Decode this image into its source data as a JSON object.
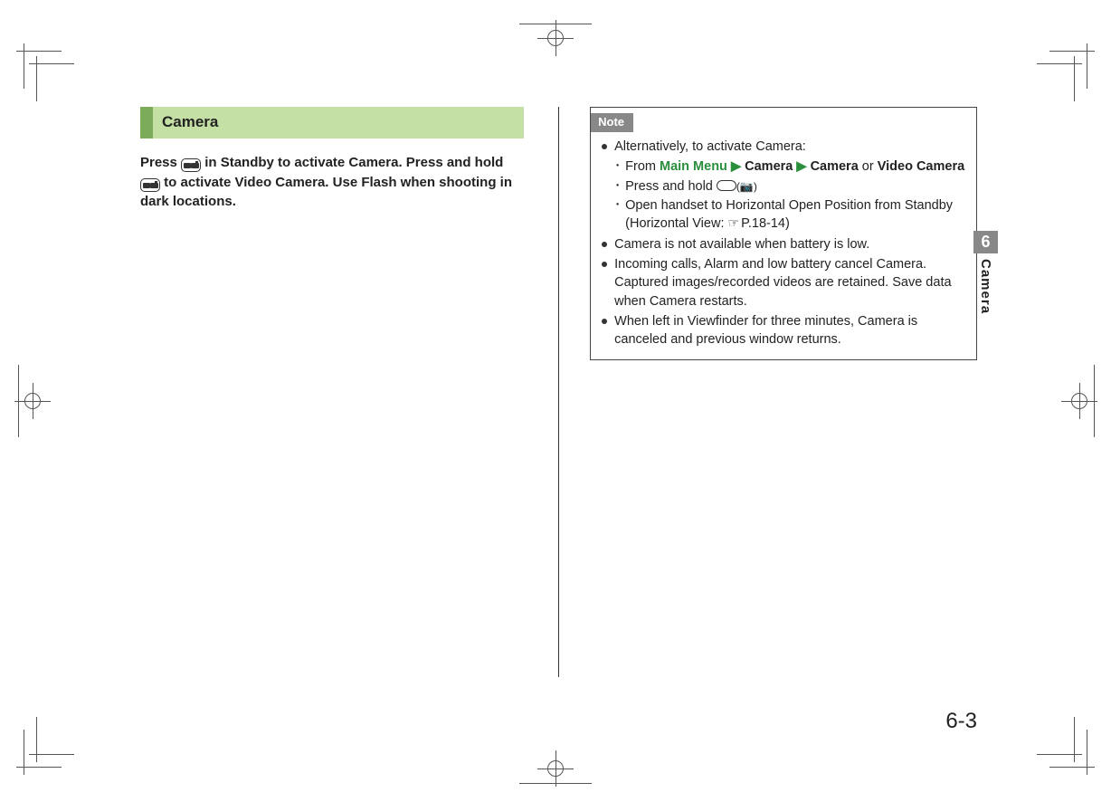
{
  "section": {
    "title": "Camera"
  },
  "intro": {
    "p1a": "Press ",
    "p1b": " in Standby to activate Camera. Press and hold ",
    "p1c": " to activate Video Camera. Use Flash when shooting in dark locations."
  },
  "note": {
    "label": "Note",
    "items": [
      {
        "text": "Alternatively, to activate Camera:",
        "sub": [
          {
            "pre": "From ",
            "link": "Main Menu",
            "tri1": " ▶ ",
            "b1": "Camera",
            "tri2": " ▶ ",
            "b2": "Camera",
            "mid": " or ",
            "b3": "Video Camera"
          },
          {
            "pre": "Press and hold ",
            "key": true,
            "post_paren": "(📷)"
          },
          {
            "pre": "Open handset to Horizontal Open Position from Standby (Horizontal View: ",
            "ref_icon": "☞",
            "ref": "P.18-14)",
            "post": ""
          }
        ]
      },
      {
        "text": "Camera is not available when battery is low."
      },
      {
        "text": "Incoming calls, Alarm and low battery cancel Camera. Captured images/recorded videos are retained. Save data when Camera restarts."
      },
      {
        "text": "When left in Viewfinder for three minutes, Camera is canceled and previous window returns."
      }
    ]
  },
  "sidetab": {
    "num": "6",
    "text": "Camera"
  },
  "page_number": "6-3"
}
